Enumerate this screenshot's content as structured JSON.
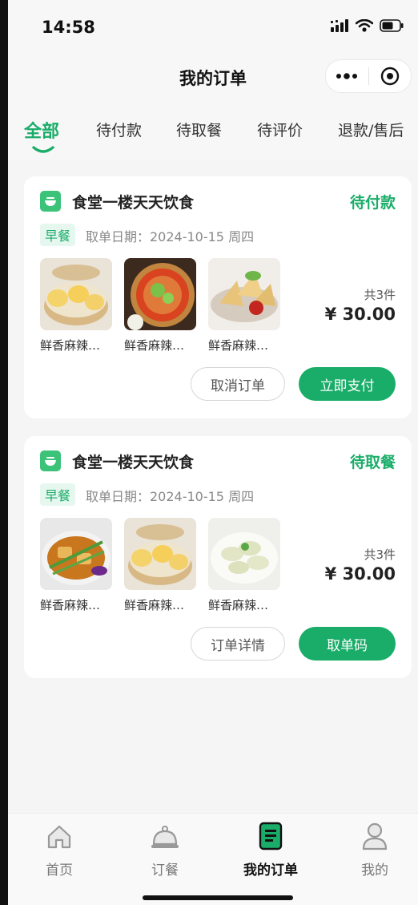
{
  "status_bar": {
    "time": "14:58"
  },
  "nav": {
    "title": "我的订单"
  },
  "tabs": [
    {
      "label": "全部",
      "active": true
    },
    {
      "label": "待付款"
    },
    {
      "label": "待取餐"
    },
    {
      "label": "待评价"
    },
    {
      "label": "退款/售后"
    }
  ],
  "orders": [
    {
      "shop": "食堂一楼天天饮食",
      "status": "待付款",
      "meal": "早餐",
      "date_label": "取单日期：2024-10-15 周四",
      "items": [
        {
          "name": "鲜香麻辣…",
          "image": "steamed-buns"
        },
        {
          "name": "鲜香麻辣…",
          "image": "noodles"
        },
        {
          "name": "鲜香麻辣…",
          "image": "samosa"
        }
      ],
      "count": "共3件",
      "price": "¥ 30.00",
      "buttons": {
        "secondary": "取消订单",
        "primary": "立即支付"
      }
    },
    {
      "shop": "食堂一楼天天饮食",
      "status": "待取餐",
      "meal": "早餐",
      "date_label": "取单日期：2024-10-15 周四",
      "items": [
        {
          "name": "鲜香麻辣…",
          "image": "tofu-stir-fry"
        },
        {
          "name": "鲜香麻辣…",
          "image": "steamed-buns"
        },
        {
          "name": "鲜香麻辣…",
          "image": "dumplings"
        }
      ],
      "count": "共3件",
      "price": "¥ 30.00",
      "buttons": {
        "secondary": "订单详情",
        "primary": "取单码"
      }
    }
  ],
  "tabbar": [
    {
      "label": "首页",
      "icon": "home-icon"
    },
    {
      "label": "订餐",
      "icon": "food-cloche-icon"
    },
    {
      "label": "我的订单",
      "icon": "order-list-icon",
      "active": true
    },
    {
      "label": "我的",
      "icon": "user-icon"
    }
  ],
  "colors": {
    "accent": "#1aad69",
    "background": "#f5f5f5"
  }
}
